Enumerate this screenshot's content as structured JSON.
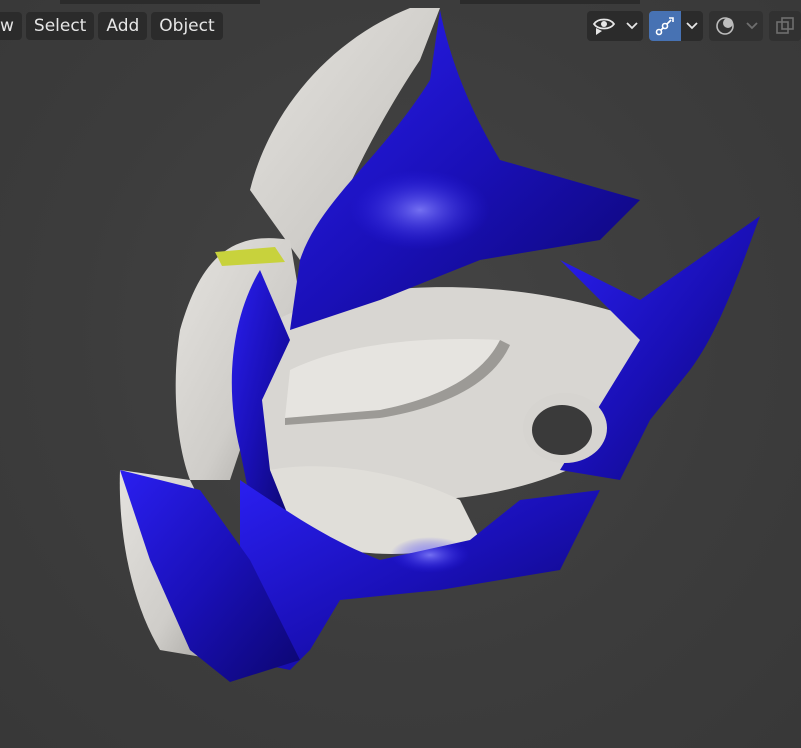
{
  "header": {
    "menus": [
      {
        "id": "view",
        "label": "w"
      },
      {
        "id": "select",
        "label": "Select"
      },
      {
        "id": "add",
        "label": "Add"
      },
      {
        "id": "object",
        "label": "Object"
      }
    ],
    "icons": {
      "visibility": "eye-icon",
      "gizmo": "gizmo-icon",
      "overlay": "overlay-icon",
      "xray": "xray-icon"
    }
  },
  "viewport": {
    "background": "#3d3d3d",
    "object": "mask-mesh",
    "colors": {
      "shell": "#dcdad6",
      "armor": "#1f12c4",
      "accent": "#c8d23c",
      "active": "#4772b3"
    }
  }
}
